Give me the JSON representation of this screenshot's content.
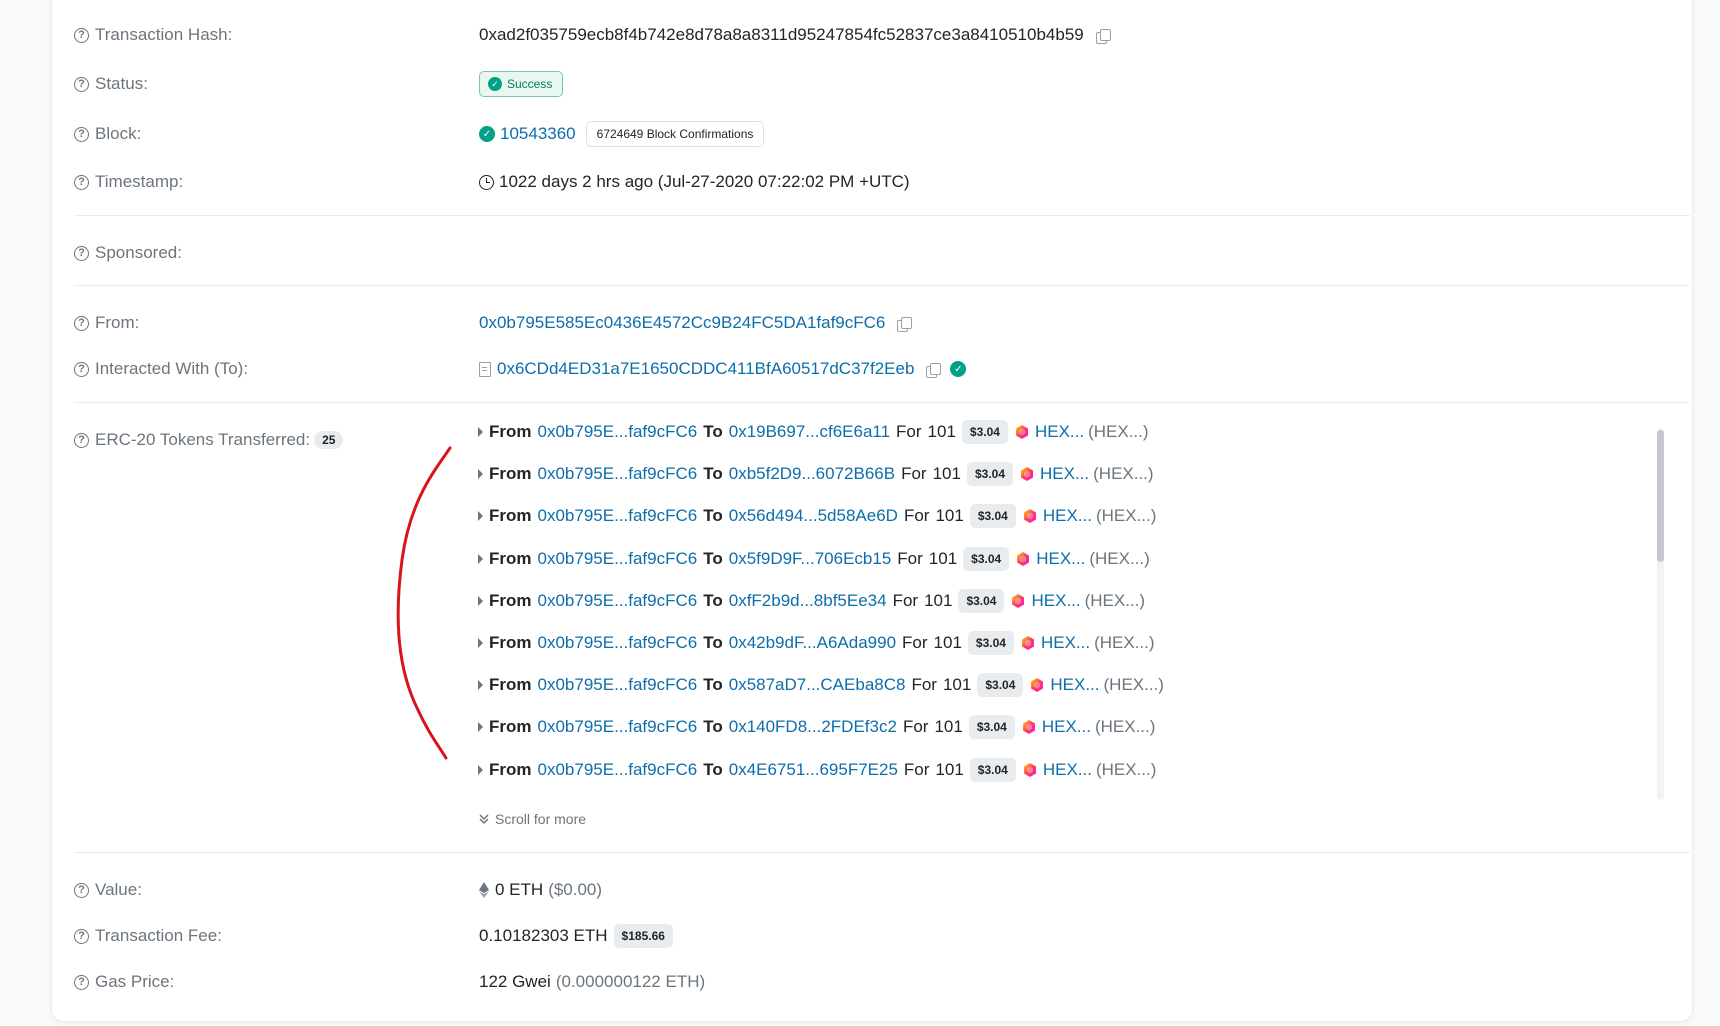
{
  "overview": {
    "tx_hash": {
      "label": "Transaction Hash:",
      "value": "0xad2f035759ecb8f4b742e8d78a8a8311d95247854fc52837ce3a8410510b4b59"
    },
    "status": {
      "label": "Status:",
      "value": "Success"
    },
    "block": {
      "label": "Block:",
      "number": "10543360",
      "confirmations": "6724649 Block Confirmations"
    },
    "timestamp": {
      "label": "Timestamp:",
      "value": "1022 days 2 hrs ago (Jul-27-2020 07:22:02 PM +UTC)"
    },
    "sponsored": {
      "label": "Sponsored:"
    },
    "from": {
      "label": "From:",
      "value": "0x0b795E585Ec0436E4572Cc9B24FC5DA1faf9cFC6"
    },
    "to": {
      "label": "Interacted With (To):",
      "value": "0x6CDd4ED31a7E1650CDDC411BfA60517dC37f2Eeb"
    },
    "tokens": {
      "label": "ERC-20 Tokens Transferred:",
      "count": "25",
      "word_from": "From",
      "word_to": "To",
      "word_for": "For",
      "scroll_more": "Scroll for more",
      "rows": [
        {
          "from": "0x0b795E...faf9cFC6",
          "to": "0x19B697...cf6E6a11",
          "amount": "101",
          "price": "$3.04",
          "token": "HEX...",
          "symbol": "(HEX...)"
        },
        {
          "from": "0x0b795E...faf9cFC6",
          "to": "0xb5f2D9...6072B66B",
          "amount": "101",
          "price": "$3.04",
          "token": "HEX...",
          "symbol": "(HEX...)"
        },
        {
          "from": "0x0b795E...faf9cFC6",
          "to": "0x56d494...5d58Ae6D",
          "amount": "101",
          "price": "$3.04",
          "token": "HEX...",
          "symbol": "(HEX...)"
        },
        {
          "from": "0x0b795E...faf9cFC6",
          "to": "0x5f9D9F...706Ecb15",
          "amount": "101",
          "price": "$3.04",
          "token": "HEX...",
          "symbol": "(HEX...)"
        },
        {
          "from": "0x0b795E...faf9cFC6",
          "to": "0xfF2b9d...8bf5Ee34",
          "amount": "101",
          "price": "$3.04",
          "token": "HEX...",
          "symbol": "(HEX...)"
        },
        {
          "from": "0x0b795E...faf9cFC6",
          "to": "0x42b9dF...A6Ada990",
          "amount": "101",
          "price": "$3.04",
          "token": "HEX...",
          "symbol": "(HEX...)"
        },
        {
          "from": "0x0b795E...faf9cFC6",
          "to": "0x587aD7...CAEba8C8",
          "amount": "101",
          "price": "$3.04",
          "token": "HEX...",
          "symbol": "(HEX...)"
        },
        {
          "from": "0x0b795E...faf9cFC6",
          "to": "0x140FD8...2FDEf3c2",
          "amount": "101",
          "price": "$3.04",
          "token": "HEX...",
          "symbol": "(HEX...)"
        },
        {
          "from": "0x0b795E...faf9cFC6",
          "to": "0x4E6751...695F7E25",
          "amount": "101",
          "price": "$3.04",
          "token": "HEX...",
          "symbol": "(HEX...)"
        }
      ]
    },
    "value": {
      "label": "Value:",
      "eth": "0 ETH",
      "usd": "($0.00)"
    },
    "fee": {
      "label": "Transaction Fee:",
      "eth": "0.10182303 ETH",
      "usd": "$185.66"
    },
    "gas": {
      "label": "Gas Price:",
      "gwei": "122 Gwei",
      "eth": "(0.000000122 ETH)"
    }
  },
  "icons": [
    "question-circle-icon",
    "copy-icon",
    "check-circle-icon",
    "clock-icon",
    "file-icon",
    "caret-right-icon",
    "hex-token-icon",
    "chevrons-down-icon",
    "ethereum-icon"
  ],
  "colors": {
    "link": "#0d6eaa",
    "success": "#00a186",
    "muted": "#6c757d",
    "annotation": "#d8141c"
  }
}
